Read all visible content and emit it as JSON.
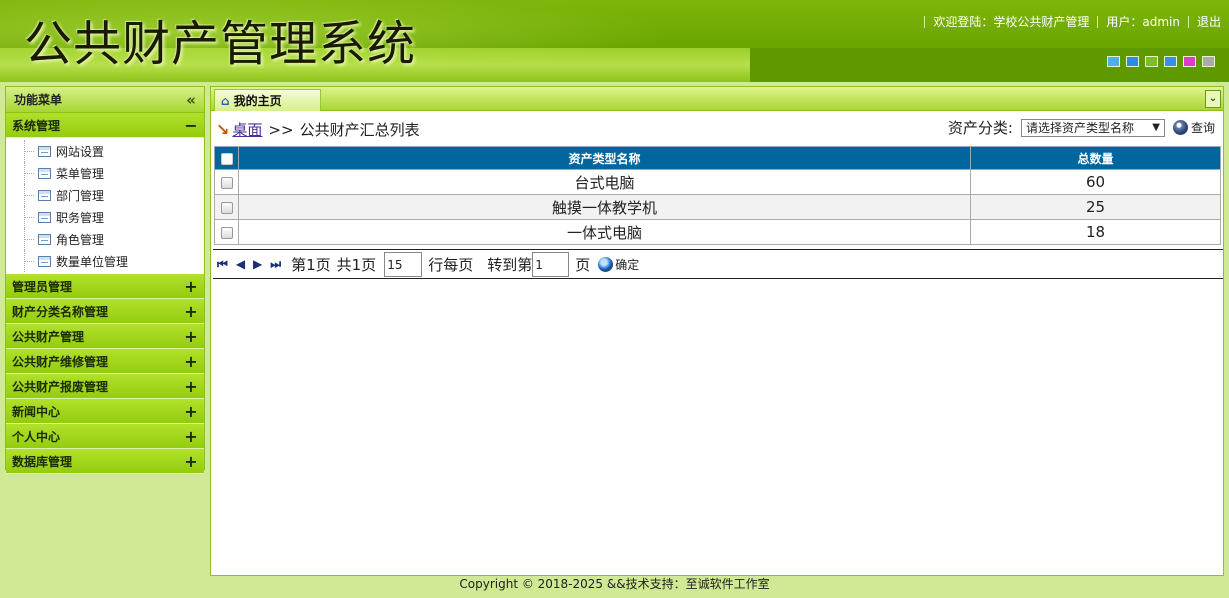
{
  "header": {
    "title": "公共财产管理系统",
    "welcome": "欢迎登陆：学校公共财产管理",
    "user": "用户：admin",
    "logout": "退出",
    "skin_colors": [
      "#4fb0e8",
      "#2a8de0",
      "#7bbf2a",
      "#3a8fe0",
      "#d640c8",
      "#aaaaaa"
    ]
  },
  "sidebar": {
    "header": "功能菜单",
    "groups": [
      {
        "label": "系统管理",
        "toggle": "−",
        "items": [
          "网站设置",
          "菜单管理",
          "部门管理",
          "职务管理",
          "角色管理",
          "数量单位管理"
        ]
      },
      {
        "label": "管理员管理",
        "toggle": "+"
      },
      {
        "label": "财产分类名称管理",
        "toggle": "+"
      },
      {
        "label": "公共财产管理",
        "toggle": "+"
      },
      {
        "label": "公共财产维修管理",
        "toggle": "+"
      },
      {
        "label": "公共财产报废管理",
        "toggle": "+"
      },
      {
        "label": "新闻中心",
        "toggle": "+"
      },
      {
        "label": "个人中心",
        "toggle": "+"
      },
      {
        "label": "数据库管理",
        "toggle": "+"
      }
    ]
  },
  "tabs": [
    {
      "label": "我的主页"
    }
  ],
  "breadcrumb": {
    "link": "桌面",
    "sep": ">>",
    "current": "公共财产汇总列表"
  },
  "filter": {
    "label": "资产分类:",
    "select_value": "请选择资产类型名称",
    "query": "查询"
  },
  "table": {
    "headers": [
      "资产类型名称",
      "总数量"
    ],
    "rows": [
      {
        "name": "台式电脑",
        "qty": "60"
      },
      {
        "name": "触摸一体教学机",
        "qty": "25"
      },
      {
        "name": "一体式电脑",
        "qty": "18"
      }
    ]
  },
  "pager": {
    "page": "第1页",
    "total": "共1页",
    "per_page_value": "15",
    "per_page_label": "行每页",
    "goto_label": "转到第",
    "goto_value": "1",
    "page_unit": "页",
    "confirm": "确定"
  },
  "footer": "Copyright © 2018-2025 &&技术支持：至诚软件工作室"
}
